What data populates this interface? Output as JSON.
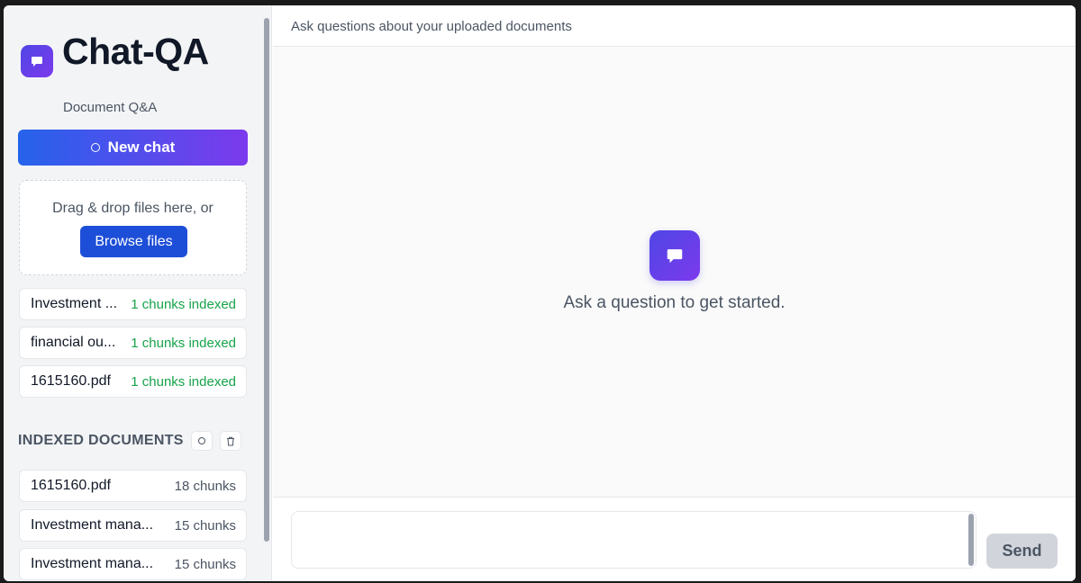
{
  "app": {
    "title": "Chat-QA",
    "subtitle": "Document Q&A"
  },
  "sidebar": {
    "new_chat_label": "New chat",
    "dropzone": {
      "text": "Drag & drop files here, or",
      "browse_label": "Browse files"
    },
    "uploads": [
      {
        "name": "Investment ...",
        "status": "1 chunks indexed"
      },
      {
        "name": "financial ou...",
        "status": "1 chunks indexed"
      },
      {
        "name": "1615160.pdf",
        "status": "1 chunks indexed"
      }
    ],
    "indexed_documents": {
      "title": "INDEXED DOCUMENTS",
      "items": [
        {
          "name": "1615160.pdf",
          "chunks": "18 chunks"
        },
        {
          "name": "Investment mana...",
          "chunks": "15 chunks"
        },
        {
          "name": "Investment mana...",
          "chunks": "15 chunks"
        }
      ]
    }
  },
  "main": {
    "header_text": "Ask questions about your uploaded documents",
    "empty_state_text": "Ask a question to get started.",
    "input_value": "",
    "send_label": "Send"
  },
  "colors": {
    "accent_gradient_start": "#4f46e5",
    "accent_gradient_end": "#7c3aed",
    "button_blue": "#1d4ed8",
    "success_green": "#16a34a"
  }
}
